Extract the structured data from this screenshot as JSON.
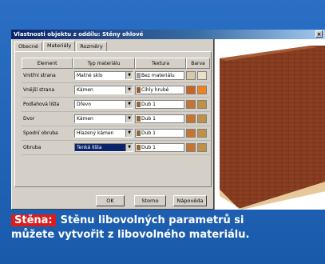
{
  "window": {
    "title": "Vlastnosti objektu z oddílu: Stěny ohlové",
    "close_glyph": "×"
  },
  "tabs": [
    {
      "label": "Obecné",
      "active": false
    },
    {
      "label": "Materiály",
      "active": true
    },
    {
      "label": "Rozměry",
      "active": false
    }
  ],
  "grid": {
    "headers": [
      "Element",
      "Typ materiálu",
      "Textura",
      "Barva"
    ],
    "rows": [
      {
        "element": "Vnitřní strana",
        "material": "Matné sklo",
        "texture": "Bez materiálu",
        "swatch": "#9a9a9a",
        "color": "#d8c8a8",
        "color2": "#eae0c8",
        "selected": false
      },
      {
        "element": "Vnější strana",
        "material": "Kámen",
        "texture": "Cihly hrubé",
        "swatch": "#9a5a32",
        "color": "#c86420",
        "color2": "#f08020",
        "selected": false
      },
      {
        "element": "Podlahová lišta",
        "material": "Dřevo",
        "texture": "Dub 1",
        "swatch": "#8a6a3e",
        "color": "#c8742c",
        "color2": "#c09048",
        "selected": false
      },
      {
        "element": "Dvor",
        "material": "Kámen",
        "texture": "Dub 1",
        "swatch": "#8a6a3e",
        "color": "#c8742c",
        "color2": "#c09048",
        "selected": false
      },
      {
        "element": "Spodní obruba",
        "material": "Hlazený kámen",
        "texture": "Dub 1",
        "swatch": "#8a6a3e",
        "color": "#c8742c",
        "color2": "#c09048",
        "selected": false
      },
      {
        "element": "Obruba",
        "material": "Tenká lišta",
        "texture": "Dub 1",
        "swatch": "#8a6a3e",
        "color": "#c8742c",
        "color2": "#c09048",
        "selected": true
      }
    ]
  },
  "buttons": {
    "ok": "OK",
    "cancel": "Storno",
    "help": "Nápověda"
  },
  "caption": {
    "label": "Stěna:",
    "line1": "Stěnu libovolných parametrů si",
    "line2": "můžete vytvořit z libovolného materiálu."
  },
  "colors": {
    "background": "#1d5fb4",
    "caption_label_bg": "#d81e1e",
    "brick": "#8a3e22"
  }
}
